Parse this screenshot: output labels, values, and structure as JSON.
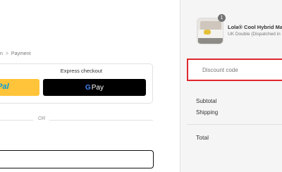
{
  "breadcrumb": {
    "previous": "n",
    "separator": ">",
    "current": "Payment"
  },
  "express_checkout": {
    "title": "Express checkout",
    "paypal_label": "yPal",
    "gpay_g": "G",
    "gpay_label": "Pay"
  },
  "divider_text": "OR",
  "email_field": {
    "value": "",
    "placeholder": ""
  },
  "order": {
    "quantity": "1",
    "product_name": "Lola® Cool Hybrid Ma",
    "product_variant": "UK Double (Dispatched in"
  },
  "discount": {
    "placeholder": "Discount code",
    "value": ""
  },
  "summary": {
    "subtotal_label": "Subtotal",
    "shipping_label": "Shipping",
    "total_label": "Total"
  },
  "colors": {
    "paypal_yellow": "#ffc439",
    "gpay_black": "#000000",
    "error_red": "#e0272f",
    "sidebar_bg": "#f5f5f5"
  }
}
